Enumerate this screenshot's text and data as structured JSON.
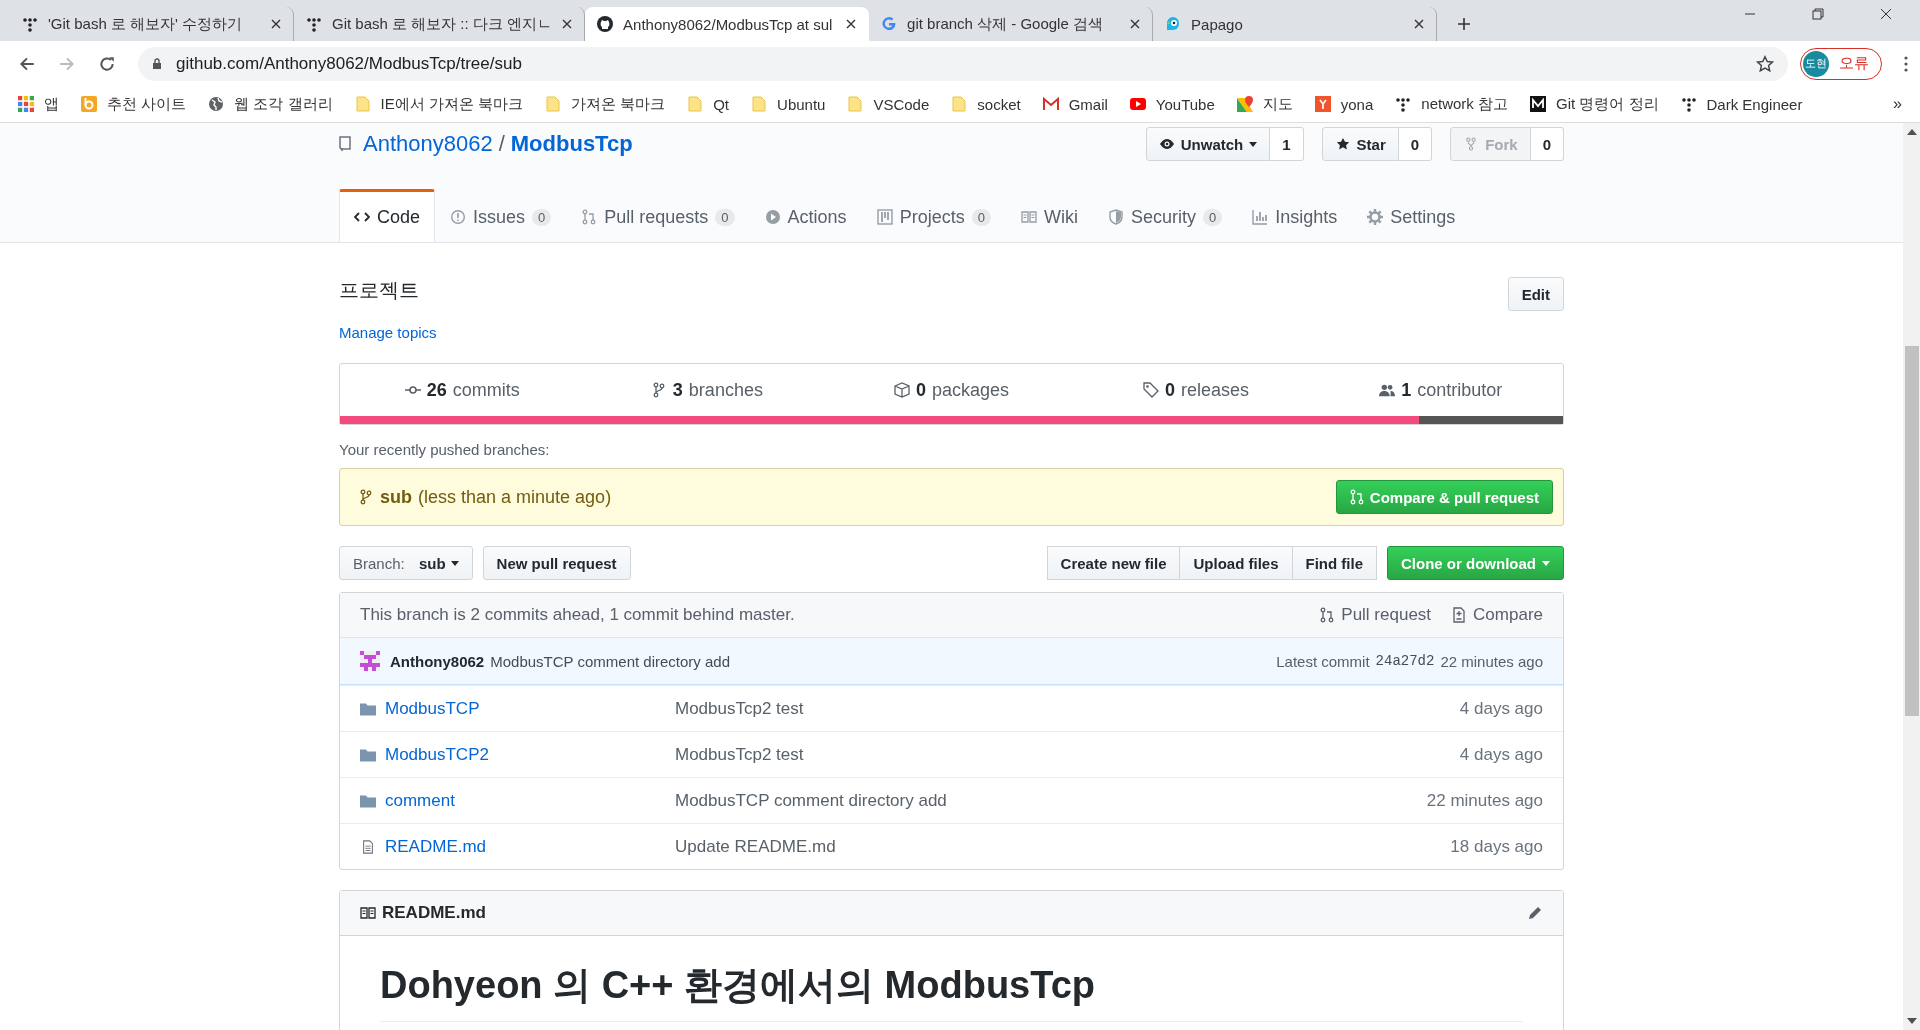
{
  "browser": {
    "tabs": [
      {
        "title": "'Git bash 로 해보자' 수정하기",
        "selected": false
      },
      {
        "title": "Git bash 로 해보자 :: 다크 엔지ㄴ",
        "selected": false
      },
      {
        "title": "Anthony8062/ModbusTcp at sul",
        "selected": true
      },
      {
        "title": "git branch 삭제 - Google 검색",
        "selected": false
      },
      {
        "title": "Papago",
        "selected": false
      }
    ],
    "address": "github.com/Anthony8062/ModbusTcp/tree/sub",
    "profile": {
      "initials": "도현",
      "label": "오류"
    },
    "bookmarks": [
      "앱",
      "추천 사이트",
      "웹 조각 갤러리",
      "IE에서 가져온 북마크",
      "가져온 북마크",
      "Qt",
      "Ubuntu",
      "VSCode",
      "socket",
      "Gmail",
      "YouTube",
      "지도",
      "yona",
      "network 참고",
      "Git 명령어 정리",
      "Dark Engineer"
    ],
    "more": "»"
  },
  "repo": {
    "owner": "Anthony8062",
    "separator": "/",
    "name": "ModbusTcp",
    "actions": [
      {
        "label": "Unwatch",
        "count": "1",
        "disabled": false
      },
      {
        "label": "Star",
        "count": "0",
        "disabled": false
      },
      {
        "label": "Fork",
        "count": "0",
        "disabled": true
      }
    ],
    "nav": [
      {
        "label": "Code",
        "selected": true
      },
      {
        "label": "Issues",
        "count": "0",
        "selected": false
      },
      {
        "label": "Pull requests",
        "count": "0",
        "selected": false
      },
      {
        "label": "Actions",
        "selected": false
      },
      {
        "label": "Projects",
        "count": "0",
        "selected": false
      },
      {
        "label": "Wiki",
        "selected": false
      },
      {
        "label": "Security",
        "count": "0",
        "selected": false
      },
      {
        "label": "Insights",
        "selected": false
      },
      {
        "label": "Settings",
        "selected": false
      }
    ],
    "description": "프로젝트",
    "edit": "Edit",
    "manage_topics": "Manage topics",
    "stats": [
      {
        "count": "26",
        "label": "commits"
      },
      {
        "count": "3",
        "label": "branches"
      },
      {
        "count": "0",
        "label": "packages"
      },
      {
        "count": "0",
        "label": "releases"
      },
      {
        "count": "1",
        "label": "contributor"
      }
    ],
    "languages": [
      {
        "color": "#f34b7d",
        "level": 0.882
      },
      {
        "color": "#555555",
        "level": 0.118
      }
    ],
    "recent_label": "Your recently pushed branches:",
    "recent": {
      "branch": "sub",
      "time": "(less than a minute ago)",
      "button": "Compare & pull request"
    },
    "branch_select": {
      "label": "Branch:",
      "value": "sub"
    },
    "new_pr": "New pull request",
    "file_buttons": [
      "Create new file",
      "Upload files",
      "Find file"
    ],
    "clone": "Clone or download",
    "branch_info": "This branch is 2 commits ahead, 1 commit behind master.",
    "pull_request": "Pull request",
    "compare": "Compare",
    "commit": {
      "author": "Anthony8062",
      "message": "ModbusTCP comment directory add",
      "latest": "Latest commit",
      "sha": "24a27d2",
      "time": "22 minutes ago"
    },
    "files": [
      {
        "kind": "dir",
        "name": "ModbusTCP",
        "message": "ModbusTcp2 test",
        "age": "4 days ago"
      },
      {
        "kind": "dir",
        "name": "ModbusTCP2",
        "message": "ModbusTcp2 test",
        "age": "4 days ago"
      },
      {
        "kind": "dir",
        "name": "comment",
        "message": "ModbusTCP comment directory add",
        "age": "22 minutes ago"
      },
      {
        "kind": "file",
        "name": "README.md",
        "message": "Update README.md",
        "age": "18 days ago"
      }
    ],
    "readme": {
      "title": "README.md",
      "heading": "Dohyeon 의 C++ 환경에서의 ModbusTcp"
    }
  }
}
